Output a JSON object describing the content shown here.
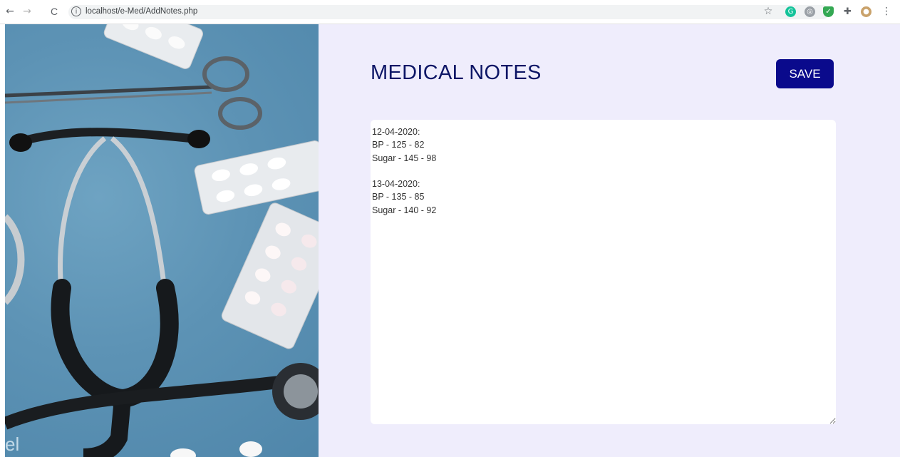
{
  "browser": {
    "url": "localhost/e-Med/AddNotes.php",
    "back_glyph": "←",
    "forward_glyph": "→",
    "reload_glyph": "C",
    "info_glyph": "i",
    "star_glyph": "☆",
    "menu_glyph": "⋮"
  },
  "photo": {
    "watermark": "el"
  },
  "page": {
    "title": "MEDICAL NOTES",
    "save_label": "SAVE"
  },
  "notes": {
    "value": "12-04-2020:\nBP - 125 - 82\nSugar - 145 - 98\n\n13-04-2020:\nBP - 135 - 85\nSugar - 140 - 92"
  },
  "colors": {
    "accent": "#0a0a8c",
    "title": "#0d1666",
    "background": "#efedfc",
    "photo_background": "#5d93b5"
  },
  "icons": [
    "back-icon",
    "forward-icon",
    "reload-icon",
    "info-icon",
    "star-icon",
    "grammarly-icon",
    "extension-icon",
    "shield-icon",
    "puzzle-icon",
    "profile-icon",
    "menu-icon"
  ]
}
